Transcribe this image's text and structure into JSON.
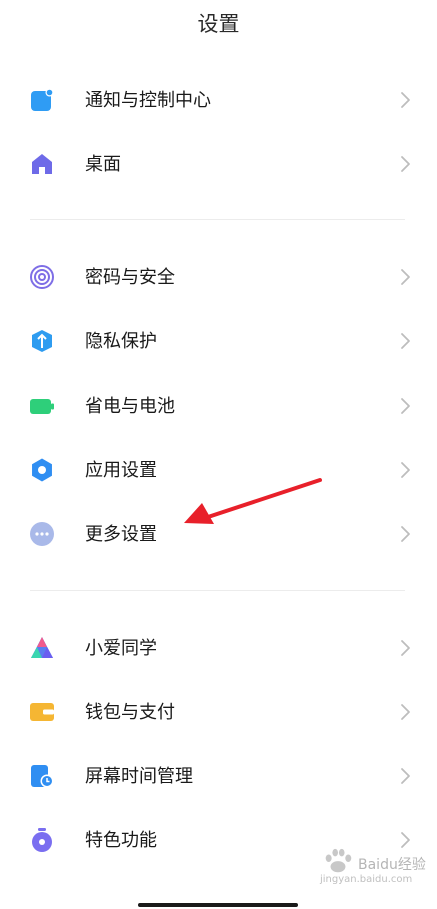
{
  "header": {
    "title": "设置"
  },
  "groups": [
    [
      {
        "label": "通知与控制中心",
        "icon": "notification-icon",
        "color": "#2f9cf4"
      },
      {
        "label": "桌面",
        "icon": "home-icon",
        "color": "#6e6ae8"
      }
    ],
    [
      {
        "label": "密码与安全",
        "icon": "fingerprint-icon",
        "color": "#7e6ee6"
      },
      {
        "label": "隐私保护",
        "icon": "privacy-shield-icon",
        "color": "#2e9cf0"
      },
      {
        "label": "省电与电池",
        "icon": "battery-icon",
        "color": "#2ecf7a"
      },
      {
        "label": "应用设置",
        "icon": "gear-icon",
        "color": "#2f8ef2"
      },
      {
        "label": "更多设置",
        "icon": "more-dots-icon",
        "color": "#a9b9e9"
      }
    ],
    [
      {
        "label": "小爱同学",
        "icon": "xiaoai-icon",
        "color": "#5b7cf0"
      },
      {
        "label": "钱包与支付",
        "icon": "wallet-icon",
        "color": "#f5b633"
      },
      {
        "label": "屏幕时间管理",
        "icon": "screen-time-icon",
        "color": "#2f8ef2"
      },
      {
        "label": "特色功能",
        "icon": "feature-icon",
        "color": "#7a6ef0"
      }
    ]
  ],
  "annotation": {
    "arrow_color": "#e8202a",
    "points_to": "更多设置"
  },
  "watermark": {
    "text": "Baidu经验",
    "sub": "jingyan.baidu.com"
  }
}
